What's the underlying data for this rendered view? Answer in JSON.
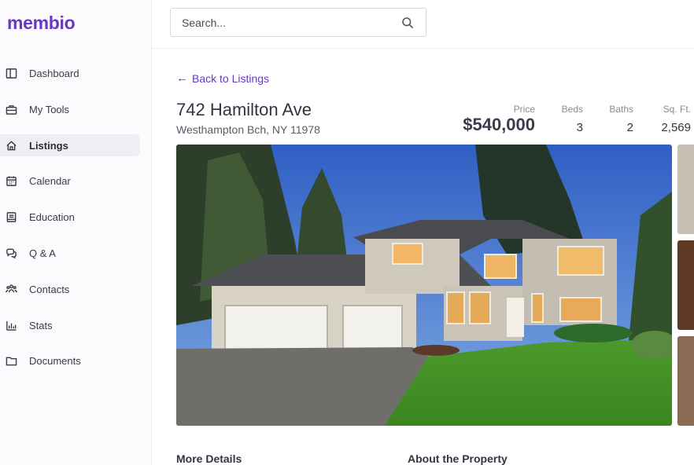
{
  "app": {
    "logo": "membio"
  },
  "sidebar": {
    "items": [
      {
        "label": "Dashboard",
        "icon": "layout-icon",
        "active": false
      },
      {
        "label": "My Tools",
        "icon": "toolbox-icon",
        "active": false
      },
      {
        "label": "Listings",
        "icon": "home-icon",
        "active": true
      },
      {
        "label": "Calendar",
        "icon": "calendar-icon",
        "active": false
      },
      {
        "label": "Education",
        "icon": "book-icon",
        "active": false
      },
      {
        "label": "Q & A",
        "icon": "chat-icon",
        "active": false
      },
      {
        "label": "Contacts",
        "icon": "people-icon",
        "active": false
      },
      {
        "label": "Stats",
        "icon": "bar-chart-icon",
        "active": false
      },
      {
        "label": "Documents",
        "icon": "folder-icon",
        "active": false
      }
    ]
  },
  "search": {
    "placeholder": "Search...",
    "value": ""
  },
  "listing": {
    "back_label": "Back to Listings",
    "address": "742 Hamilton Ave",
    "city_line": "Westhampton Bch, NY 11978",
    "price_label": "Price",
    "price": "$540,000",
    "beds_label": "Beds",
    "beds": "3",
    "baths_label": "Baths",
    "baths": "2",
    "sqft_label": "Sq. Ft.",
    "sqft": "2,569"
  },
  "sections": {
    "more_details": "More Details",
    "about": "About the Property"
  },
  "colors": {
    "accent": "#6a35c9",
    "active_nav_bg": "#eeeef4",
    "sidebar_bg": "#fbfbfd"
  }
}
